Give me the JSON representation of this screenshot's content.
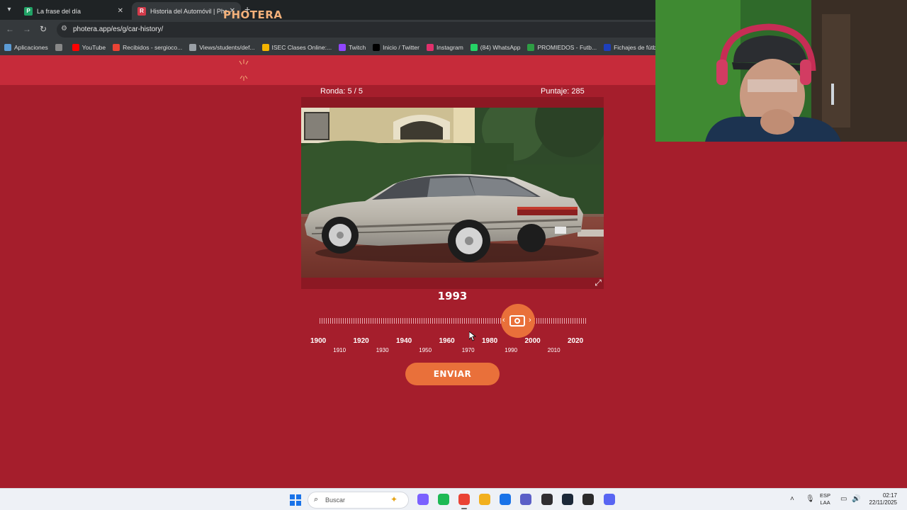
{
  "browser": {
    "tab_menu_icon": "chevron-down-icon",
    "tabs": [
      {
        "title": "La frase del día",
        "favicon": "P",
        "favicon_color": "#21a366"
      },
      {
        "title": "Historia del Automóvil | Photera",
        "favicon": "R",
        "favicon_color": "#d23a4a"
      }
    ],
    "url": "photera.app/es/g/car-history/",
    "bookmarks": [
      {
        "label": "Aplicaciones",
        "icon": "apps-grid-icon",
        "color": "#5b9bd5"
      },
      {
        "label": "",
        "icon": "grid-icon",
        "color": "#888888"
      },
      {
        "label": "YouTube",
        "icon": "youtube-icon",
        "color": "#ff0000"
      },
      {
        "label": "Recibidos - sergioco...",
        "icon": "gmail-icon",
        "color": "#ea4335"
      },
      {
        "label": "Views/students/def...",
        "icon": "document-icon",
        "color": "#9aa0a6"
      },
      {
        "label": "ISEC Clases Online:...",
        "icon": "isec-icon",
        "color": "#f4b400"
      },
      {
        "label": "Twitch",
        "icon": "twitch-icon",
        "color": "#9146ff"
      },
      {
        "label": "Inicio / Twitter",
        "icon": "x-icon",
        "color": "#000000"
      },
      {
        "label": "Instagram",
        "icon": "instagram-icon",
        "color": "#e1306c"
      },
      {
        "label": "(84) WhatsApp",
        "icon": "whatsapp-icon",
        "color": "#25d366"
      },
      {
        "label": "PROMIEDOS - Futb...",
        "icon": "promiedos-icon",
        "color": "#2e9e44"
      },
      {
        "label": "Fichajes de fútbol, r...",
        "icon": "tm-icon",
        "color": "#1d3fbb"
      }
    ]
  },
  "page": {
    "logo": "PHOTERA",
    "round_label": "Ronda: 5 / 5",
    "score_label": "Puntaje: 285",
    "selected_year": "1993",
    "selected_fraction": 0.74,
    "timeline_major": [
      "1900",
      "1920",
      "1940",
      "1960",
      "1980",
      "2000",
      "2020"
    ],
    "timeline_minor": [
      "1910",
      "1930",
      "1950",
      "1970",
      "1990",
      "2010"
    ],
    "submit_label": "ENVIAR"
  },
  "taskbar": {
    "search_placeholder": "Buscar",
    "lang_top": "ESP",
    "lang_bottom": "LAA",
    "time": "02:17",
    "date": "22/11/2025",
    "apps": [
      {
        "name": "copilot-icon",
        "color": "#7b61ff"
      },
      {
        "name": "spotify-icon",
        "color": "#1db954"
      },
      {
        "name": "chrome-icon",
        "color": "#ea4335"
      },
      {
        "name": "file-explorer-icon",
        "color": "#f2b01e"
      },
      {
        "name": "store-icon",
        "color": "#1a73e8"
      },
      {
        "name": "teams-icon",
        "color": "#5b5fc7"
      },
      {
        "name": "obs-icon",
        "color": "#302e31"
      },
      {
        "name": "steam-icon",
        "color": "#1b2838"
      },
      {
        "name": "epic-icon",
        "color": "#2b2b2b"
      },
      {
        "name": "discord-icon",
        "color": "#5865f2"
      }
    ]
  }
}
